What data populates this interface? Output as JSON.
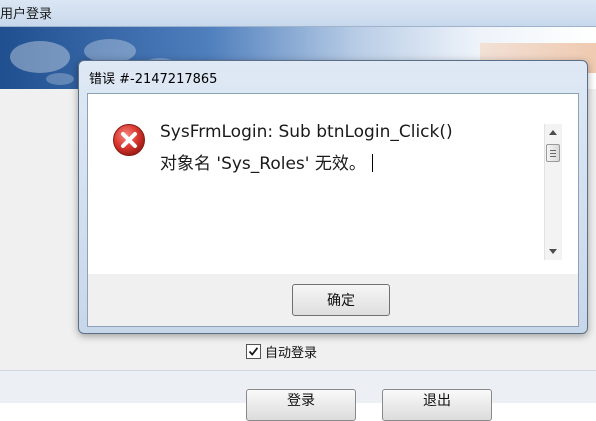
{
  "background_window": {
    "title": "用户登录",
    "auto_login_label": "自动登录",
    "auto_login_checked": true,
    "login_button": "登录",
    "exit_button": "退出"
  },
  "error_dialog": {
    "title": "错误 #-2147217865",
    "icon": "error-x-icon",
    "message_line1": "SysFrmLogin: Sub btnLogin_Click()",
    "message_line2": "对象名 'Sys_Roles' 无效。",
    "ok_button": "确定"
  },
  "colors": {
    "error_icon_red": "#d9372f",
    "dialog_frame": "#c7d7ea"
  }
}
